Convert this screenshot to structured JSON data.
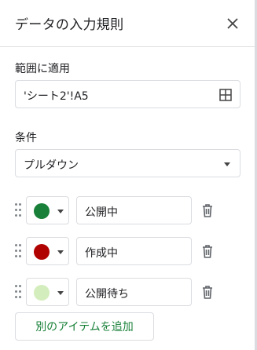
{
  "panel": {
    "title": "データの入力規則"
  },
  "range": {
    "label": "範囲に適用",
    "value": "'シート2'!A5"
  },
  "condition": {
    "label": "条件",
    "value": "プルダウン"
  },
  "items": [
    {
      "value": "公開中",
      "color": "#188038"
    },
    {
      "value": "作成中",
      "color": "#b10202"
    },
    {
      "value": "公開待ち",
      "color": "#d4edbc"
    }
  ],
  "add_button_label": "別のアイテムを追加",
  "colors": {
    "accent_green": "#188038",
    "border": "#dadce0"
  }
}
